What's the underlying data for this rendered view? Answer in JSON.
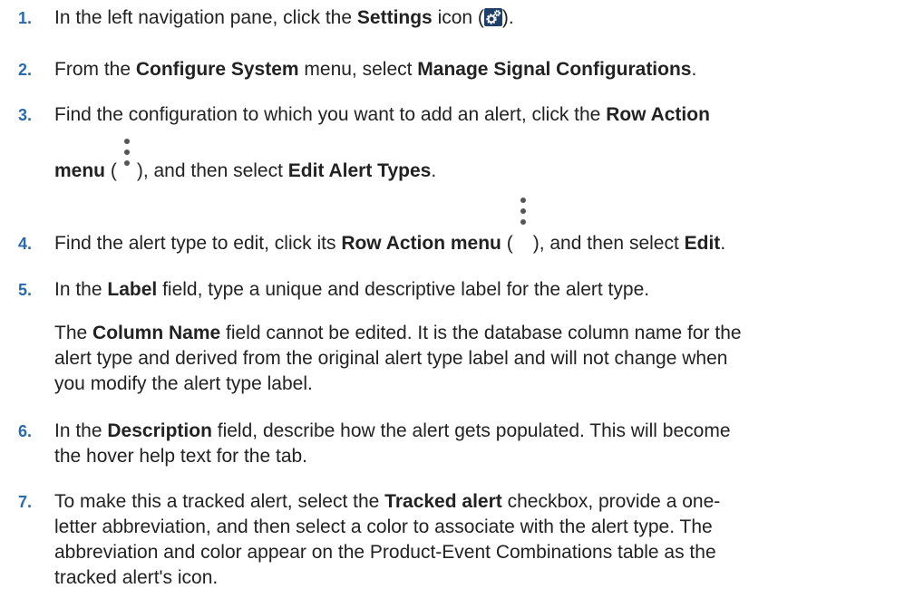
{
  "steps": [
    {
      "num": "1.",
      "p1": "In the left navigation pane, click the ",
      "b1": "Settings",
      "p2": " icon (",
      "icon": "settings-icon",
      "p3": ")."
    },
    {
      "num": "2.",
      "p1": "From the ",
      "b1": "Configure System",
      "p2": " menu, select ",
      "b2": "Manage Signal Configurations",
      "p3": "."
    },
    {
      "num": "3.",
      "p1": "Find the configuration to which you want to add an alert, click the ",
      "b1": "Row Action",
      "b2": "menu",
      "p2": " (",
      "icon": "kebab-icon",
      "p3": "), and then select ",
      "b3": "Edit Alert Types",
      "p4": "."
    },
    {
      "num": "4.",
      "p1": "Find the alert type to edit, click its ",
      "b1": "Row Action menu",
      "p2": " (",
      "icon": "kebab-icon",
      "p3": "), and then select ",
      "b2": "Edit",
      "p4": "."
    },
    {
      "num": "5.",
      "p1": "In the ",
      "b1": "Label",
      "p2": " field, type a unique and descriptive label for the alert type.",
      "note_b": "Column Name",
      "note_l1": " field cannot be edited. It is the database column name for the",
      "note_pre": "The ",
      "note_l2": "alert type and derived from the original alert type label and will not change when",
      "note_l3": "you modify the alert type label."
    },
    {
      "num": "6.",
      "p1": "In the ",
      "b1": "Description",
      "p2": " field, describe how the alert gets populated. This will become",
      "l2": "the hover help text for the tab."
    },
    {
      "num": "7.",
      "p1": "To make this a tracked alert, select the ",
      "b1": "Tracked alert",
      "p2": " checkbox, provide a one-",
      "l2": "letter abbreviation, and then select a color to associate with the alert type. The",
      "l3": "abbreviation and color appear on the Product-Event Combinations table as the",
      "l4": "tracked alert's icon."
    }
  ]
}
